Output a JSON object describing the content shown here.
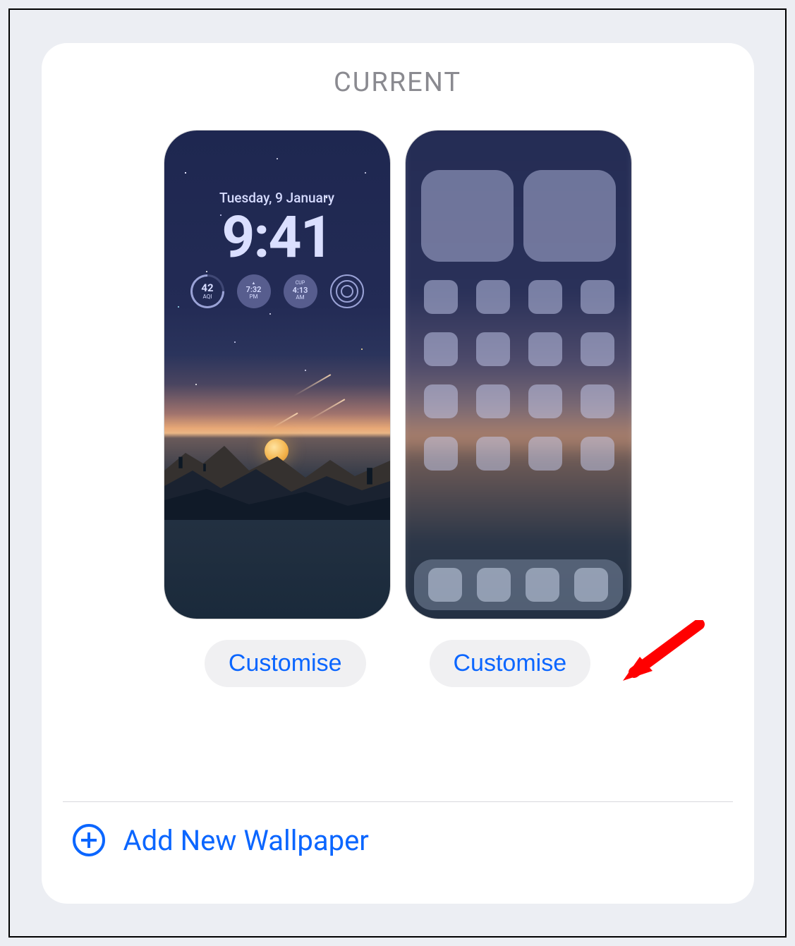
{
  "header": {
    "title": "CURRENT"
  },
  "lock_screen": {
    "date": "Tuesday, 9 January",
    "time": "9:41",
    "widgets": {
      "aqi": {
        "value": "42",
        "label": "AQI"
      },
      "clock1": {
        "time": "7:32",
        "period": "PM"
      },
      "clock2": {
        "label": "CUP",
        "time": "4:13",
        "period": "AM"
      },
      "activity": {
        "name": "activity-rings"
      }
    }
  },
  "buttons": {
    "customise_lock": "Customise",
    "customise_home": "Customise",
    "add_wallpaper": "Add New Wallpaper"
  },
  "colors": {
    "accent": "#0b66ff",
    "annotation": "#ff0000"
  }
}
